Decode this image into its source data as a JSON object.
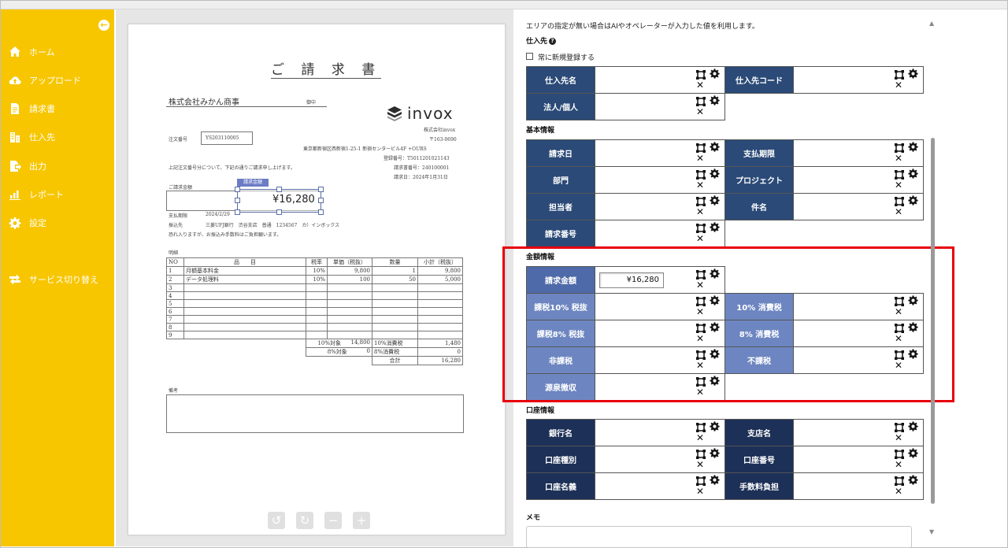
{
  "sidebar": {
    "items": [
      {
        "label": "ホーム",
        "icon": "home-icon"
      },
      {
        "label": "アップロード",
        "icon": "cloud-upload-icon"
      },
      {
        "label": "請求書",
        "icon": "document-icon"
      },
      {
        "label": "仕入先",
        "icon": "building-icon"
      },
      {
        "label": "出力",
        "icon": "export-icon"
      },
      {
        "label": "レポート",
        "icon": "chart-icon"
      },
      {
        "label": "設定",
        "icon": "gear-icon"
      },
      {
        "label": "サービス切り替え",
        "icon": "switch-icon"
      }
    ],
    "accent": "#f7c600"
  },
  "document": {
    "title": "ご 請 求 書",
    "recipient": "株式会社みかん商事",
    "honorific": "御中",
    "order_label": "注文番号",
    "order_no": "YS203110005",
    "logo_text": "invox",
    "company": "株式会社invox",
    "postal": "〒163-0690",
    "address": "東京都新宿区西新宿1-25-1 新宿センタービル4F +OURS",
    "reg_no": "登録番号：T5011201021143",
    "invoice_no": "請求書番号：240100001",
    "invoice_date": "請求日：2024年1月31日",
    "intro": "上記注文番号分について、下記の通りご請求申し上げます。",
    "amount_label": "ご請求金額",
    "amount_value": "¥16,280",
    "sel_tag": "請求金額",
    "due_label": "支払期限",
    "due_value": "2024/2/29",
    "bank_label": "振込先",
    "bank_value": "三菱UFJ銀行　渋谷支店　普通　1234567　カ）インボックス",
    "note_line": "恐れ入りますが、お振込み手数料はご負担願います。",
    "detail_label": "明細",
    "remarks_label": "備考",
    "table_headers": [
      "NO",
      "品　　目",
      "税率",
      "単価（税抜）",
      "数量",
      "小計（税抜）"
    ],
    "rows": [
      [
        "1",
        "月額基本料金",
        "10%",
        "9,800",
        "1",
        "9,800"
      ],
      [
        "2",
        "データ処理料",
        "10%",
        "100",
        "50",
        "5,000"
      ],
      [
        "3",
        "",
        "",
        "",
        "",
        ""
      ],
      [
        "4",
        "",
        "",
        "",
        "",
        ""
      ],
      [
        "5",
        "",
        "",
        "",
        "",
        ""
      ],
      [
        "6",
        "",
        "",
        "",
        "",
        ""
      ],
      [
        "7",
        "",
        "",
        "",
        "",
        ""
      ],
      [
        "8",
        "",
        "",
        "",
        "",
        ""
      ],
      [
        "9",
        "",
        "",
        "",
        "",
        ""
      ]
    ],
    "summary": [
      [
        "10%対象",
        "14,800",
        "10%消費税",
        "1,480"
      ],
      [
        "8%対象",
        "0",
        "8%消費税",
        "0"
      ],
      [
        "",
        "",
        "合計",
        "16,280"
      ]
    ],
    "controls": [
      "↺",
      "↻",
      "−",
      "+"
    ]
  },
  "panel": {
    "note": "エリアの指定が無い場合はAIやオペレーターが入力した値を利用します。",
    "supplier_title": "仕入先",
    "always_new_label": "常に新規登録する",
    "supplier_fields": [
      [
        "仕入先名",
        "仕入先コード"
      ],
      [
        "法人/個人",
        ""
      ]
    ],
    "basic_title": "基本情報",
    "basic_fields": [
      [
        "請求日",
        "支払期限"
      ],
      [
        "部門",
        "プロジェクト"
      ],
      [
        "担当者",
        "件名"
      ],
      [
        "請求番号",
        ""
      ]
    ],
    "amount_title": "金額情報",
    "amount_fields": [
      [
        "請求金額",
        ""
      ],
      [
        "課税10% 税抜",
        "10% 消費税"
      ],
      [
        "課税8% 税抜",
        "8% 消費税"
      ],
      [
        "非課税",
        "不課税"
      ],
      [
        "源泉徴収",
        ""
      ]
    ],
    "amount_value": "¥16,280",
    "account_title": "口座情報",
    "account_fields": [
      [
        "銀行名",
        "支店名"
      ],
      [
        "口座種別",
        "口座番号"
      ],
      [
        "口座名義",
        "手数料負担"
      ]
    ],
    "memo_title": "メモ",
    "highlight_color": "#e8000a"
  }
}
